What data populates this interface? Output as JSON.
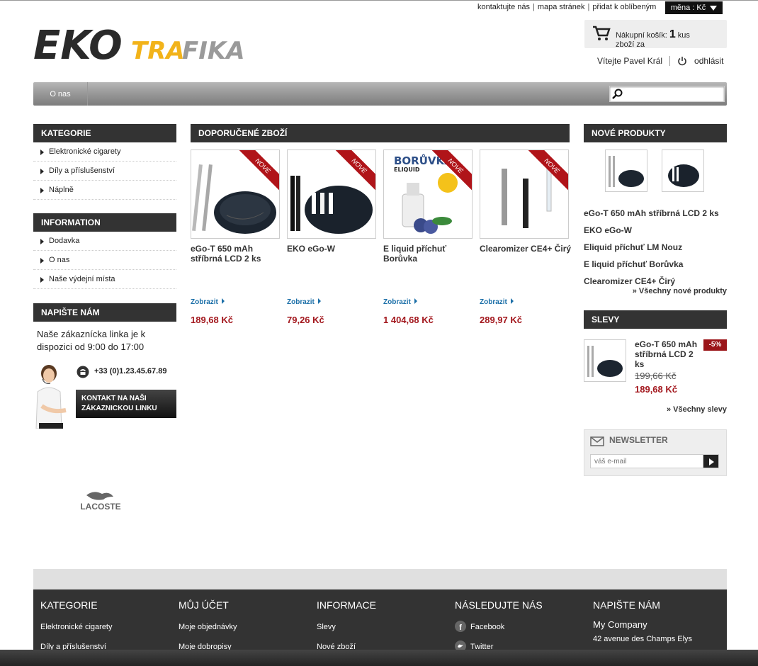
{
  "top_links": {
    "contact": "kontaktujte nás",
    "sitemap": "mapa stránek",
    "favorites": "přidat k oblíbeným",
    "currency": "měna : Kč"
  },
  "logo": {
    "part1": "EKO",
    "part2": "TRA",
    "part3": "FIKA"
  },
  "cart": {
    "label": "Nákupní košík:",
    "count": "1",
    "unit": "kus",
    "line2": "zboží za"
  },
  "user": {
    "welcome": "Vítejte Pavel Král",
    "logout": "odhlásit"
  },
  "nav": {
    "item": "O nas"
  },
  "search": {
    "placeholder": ""
  },
  "left": {
    "categories_title": "KATEGORIE",
    "categories": [
      "Elektronické cigarety",
      "Díly a příslušenství",
      "Náplně"
    ],
    "info_title": "INFORMATION",
    "info": [
      "Dodavka",
      "O nas",
      "Naše výdejní místa"
    ],
    "write_title": "NAPIŠTE NÁM",
    "hotline_text": "Naše zákaznícka linka je k dispozici od 9:00 do 17:00",
    "phone": "+33 (0)1.23.45.67.89",
    "contact_button": "KONTAKT NA NAŠI ZÁKAZNICKOU LINKU",
    "brand_logo": "LACOSTE"
  },
  "featured": {
    "title": "DOPORUČENÉ ZBOŽÍ",
    "ribbon": "NOVÉ",
    "show_label": "Zobrazit",
    "products": [
      {
        "name": "eGo-T 650 mAh stříbrná LCD 2 ks",
        "price": "189,68 Kč"
      },
      {
        "name": "EKO eGo-W",
        "price": "79,26 Kč"
      },
      {
        "name": "E liquid příchuť Borůvka",
        "price": "1 404,68 Kč",
        "img_text": "BORŮVKA",
        "img_sub": "ELIQUID"
      },
      {
        "name": "Clearomizer CE4+ Čirý",
        "price": "289,97 Kč"
      }
    ]
  },
  "new_products": {
    "title": "NOVÉ PRODUKTY",
    "items": [
      "eGo-T 650 mAh stříbrná LCD 2 ks",
      "EKO eGo-W",
      "Eliquid příchuť LM Nouz",
      "E liquid příchuť Borůvka",
      "Clearomizer CE4+ Čirý"
    ],
    "all_link": "» Všechny nové produkty"
  },
  "sale": {
    "title": "SLEVY",
    "name": "eGo-T 650 mAh stříbrná LCD 2 ks",
    "discount": "-5%",
    "old_price": "199,66 Kč",
    "price": "189,68 Kč",
    "all_link": "» Všechny slevy"
  },
  "newsletter": {
    "title": "NEWSLETTER",
    "placeholder": "váš e-mail"
  },
  "footer": {
    "col1_title": "KATEGORIE",
    "col1": [
      "Elektronické cigarety",
      "Díly a příslušenství"
    ],
    "col2_title": "MŮJ ÚČET",
    "col2": [
      "Moje objednávky",
      "Moje dobropisy"
    ],
    "col3_title": "INFORMACE",
    "col3": [
      "Slevy",
      "Nové zboží"
    ],
    "col4_title": "NÁSLEDUJTE NÁS",
    "col4": [
      "Facebook",
      "Twitter"
    ],
    "col5_title": "NAPIŠTE NÁM",
    "company": "My Company",
    "address": "42 avenue des Champs Elys"
  },
  "colors": {
    "accent_red": "#a3181e",
    "link_blue": "#1b6fa8",
    "header_dark": "#333333",
    "logo_yellow": "#f2b31a"
  }
}
